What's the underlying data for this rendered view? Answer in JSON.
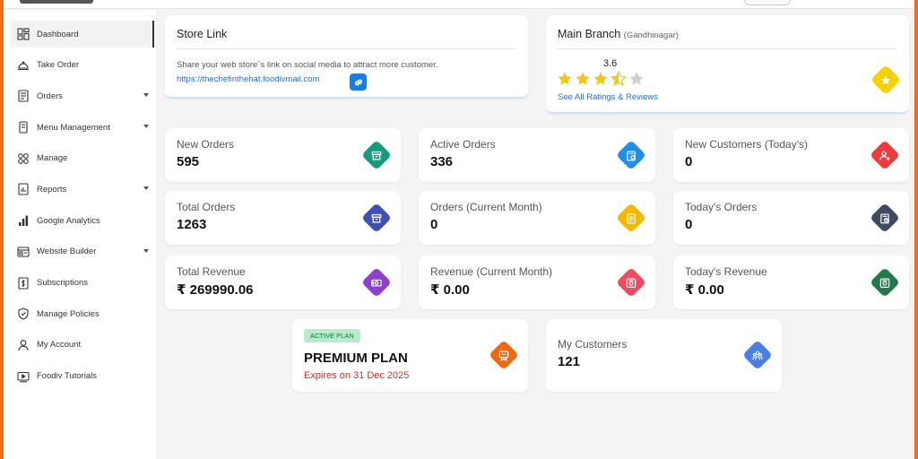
{
  "sidebar": {
    "items": [
      {
        "label": "Dashboard",
        "icon": "dashboard-icon",
        "active": true
      },
      {
        "label": "Take Order",
        "icon": "cloche-icon"
      },
      {
        "label": "Orders",
        "icon": "orders-icon",
        "caret": true
      },
      {
        "label": "Menu Management",
        "icon": "menu-book-icon",
        "caret": true
      },
      {
        "label": "Manage",
        "icon": "grid-icon"
      },
      {
        "label": "Reports",
        "icon": "reports-icon",
        "caret": true
      },
      {
        "label": "Google Analytics",
        "icon": "bar-chart-icon"
      },
      {
        "label": "Website Builder",
        "icon": "website-icon",
        "caret": true
      },
      {
        "label": "Subscriptions",
        "icon": "subscription-icon"
      },
      {
        "label": "Manage Policies",
        "icon": "shield-icon"
      },
      {
        "label": "My Account",
        "icon": "user-icon"
      },
      {
        "label": "Foodiv Tutorials",
        "icon": "video-icon"
      }
    ]
  },
  "store_link": {
    "title": "Store Link",
    "description": "Share your web store`s link on social media to attract more customer.",
    "url": "https://thechefinthehat.foodivmail.com"
  },
  "branch": {
    "title": "Main Branch",
    "location": "(Gandhinagar)",
    "rating": "3.6",
    "rating_value": 3.6,
    "ratings_link": "See All Ratings & Reviews"
  },
  "stats": [
    {
      "label": "New Orders",
      "value": "595",
      "color": "#159c7d",
      "icon": "box-icon"
    },
    {
      "label": "Active Orders",
      "value": "336",
      "color": "#1e8ff0",
      "icon": "clipboard-check-icon"
    },
    {
      "label": "New Customers (Today's)",
      "value": "0",
      "color": "#ef3b3b",
      "icon": "user-add-icon"
    },
    {
      "label": "Total Orders",
      "value": "1263",
      "color": "#3e4fb5",
      "icon": "box-icon"
    },
    {
      "label": "Orders (Current Month)",
      "value": "0",
      "color": "#f5b800",
      "icon": "clipboard-icon"
    },
    {
      "label": "Today's Orders",
      "value": "0",
      "color": "#3f4a63",
      "icon": "clipboard-clock-icon"
    },
    {
      "label": "Total Revenue",
      "value": "₹ 269990.06",
      "color": "#8e3fce",
      "icon": "cash-icon"
    },
    {
      "label": "Revenue (Current Month)",
      "value": "₹ 0.00",
      "color": "#ee4a60",
      "icon": "wallet-icon"
    },
    {
      "label": "Today's Revenue",
      "value": "₹ 0.00",
      "color": "#22794a",
      "icon": "wallet-icon"
    }
  ],
  "plan": {
    "badge": "ACTIVE PLAN",
    "name": "PREMIUM PLAN",
    "expires": "Expires on 31 Dec 2025",
    "color": "#ee6a10",
    "icon": "plan-icon"
  },
  "customers": {
    "label": "My Customers",
    "value": "121",
    "color": "#4a7fe6",
    "icon": "users-icon"
  }
}
